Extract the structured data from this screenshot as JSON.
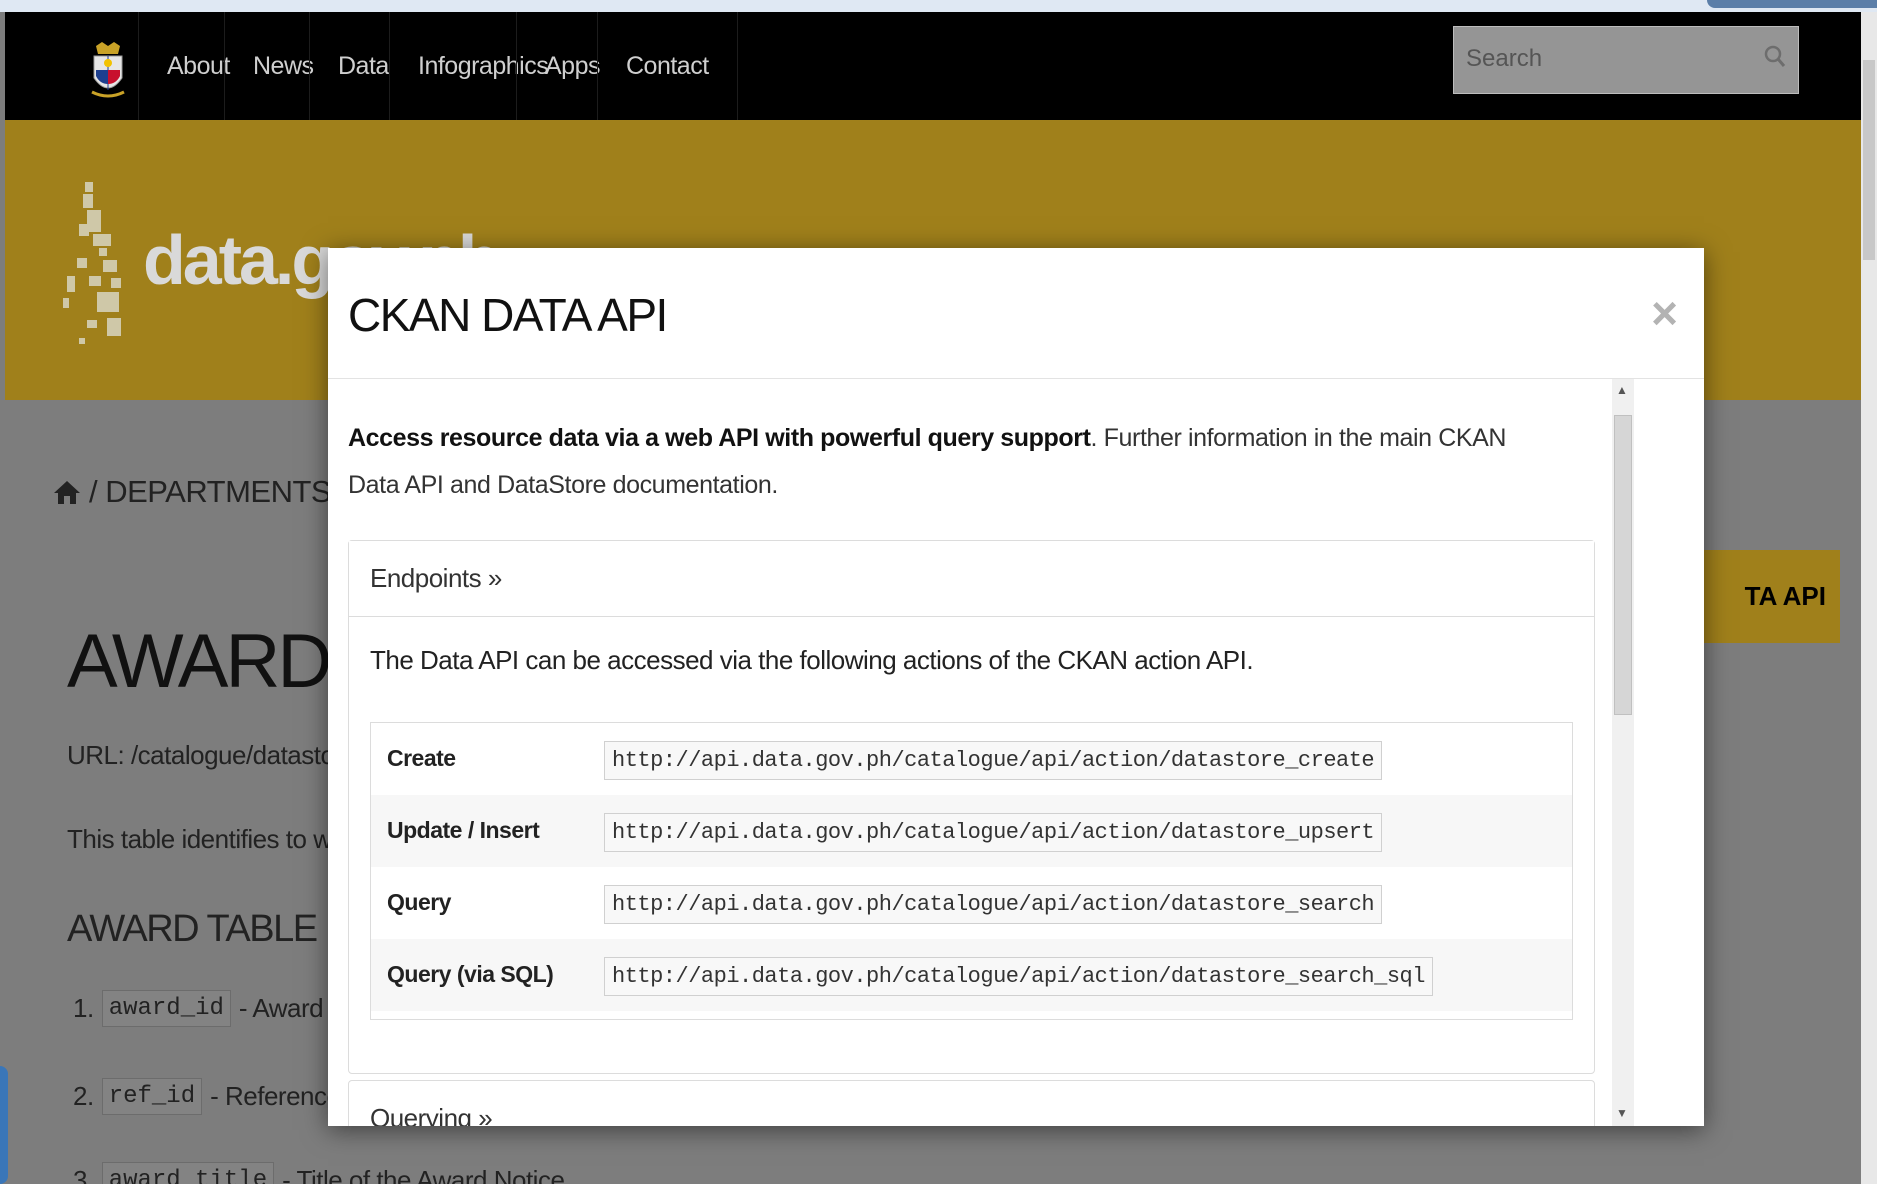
{
  "navbar": {
    "items": [
      "About",
      "News",
      "Data",
      "Infographics",
      "Apps",
      "Contact"
    ],
    "search_placeholder": "Search"
  },
  "banner": {
    "logo_text": "data.gov.ph"
  },
  "breadcrumb": {
    "text": "/ DEPARTMENTS / PH"
  },
  "page": {
    "title": "AWARD",
    "url_text": "URL: /catalogue/datastore,",
    "desc_text": "This table identifies to whic",
    "section_title": "AWARD TABLE (COLU",
    "list": [
      {
        "num": "1.",
        "code": "award_id",
        "text": "- Award not"
      },
      {
        "num": "2.",
        "code": "ref_id",
        "text": "- Reference Nu"
      },
      {
        "num": "3.",
        "code": "award_title",
        "text": "- Title of the Award Notice."
      }
    ],
    "data_api_button": "TA API"
  },
  "modal": {
    "title": "CKAN DATA API",
    "close": "×",
    "intro_bold": "Access resource data via a web API with powerful query support",
    "intro_rest": ". Further information in the main CKAN Data API and DataStore documentation.",
    "endpoints_header": "Endpoints »",
    "endpoints_text": "The Data API can be accessed via the following actions of the CKAN action API.",
    "endpoints": [
      {
        "label": "Create",
        "url": "http://api.data.gov.ph/catalogue/api/action/datastore_create"
      },
      {
        "label": "Update / Insert",
        "url": "http://api.data.gov.ph/catalogue/api/action/datastore_upsert"
      },
      {
        "label": "Query",
        "url": "http://api.data.gov.ph/catalogue/api/action/datastore_search"
      },
      {
        "label": "Query (via SQL)",
        "url": "http://api.data.gov.ph/catalogue/api/action/datastore_search_sql"
      }
    ],
    "querying_header": "Querying »"
  },
  "colors": {
    "navbar_bg": "#000000",
    "banner_gold": "#a0801b",
    "overlay_gray": "#7d7d7d",
    "modal_bg": "#ffffff"
  }
}
